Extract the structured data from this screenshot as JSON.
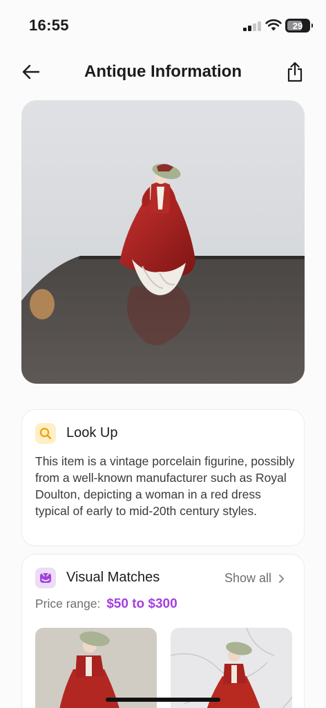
{
  "status_bar": {
    "time": "16:55",
    "battery": "29",
    "battery_level": 0.29
  },
  "nav": {
    "title": "Antique Information"
  },
  "lookup": {
    "title": "Look Up",
    "description": "This item is a vintage porcelain figurine, possibly from a well-known manufacturer such as Royal Doulton, depicting a woman in a red dress typical of early to mid-20th century styles."
  },
  "matches": {
    "title": "Visual Matches",
    "show_all": "Show all",
    "price_label": "Price range:",
    "price_value": "$50 to $300"
  },
  "colors": {
    "accent": "#a43fe0",
    "lookup_icon_bg": "#fdf0c8",
    "matches_icon_bg": "#ecdcf6"
  }
}
